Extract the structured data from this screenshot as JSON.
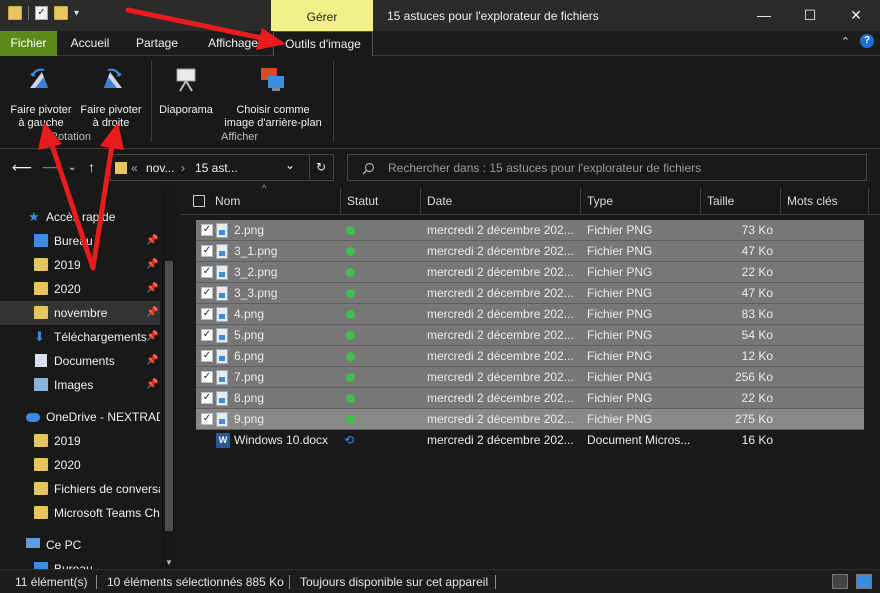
{
  "window": {
    "title": "15 astuces pour l'explorateur de fichiers",
    "context_tab": "Gérer",
    "minimize": "—",
    "maximize": "☐",
    "close": "✕"
  },
  "tabs": [
    "Fichier",
    "Accueil",
    "Partage",
    "Affichage",
    "Outils d'image"
  ],
  "ribbon": {
    "rotate_left": [
      "Faire pivoter",
      "à gauche"
    ],
    "rotate_right": [
      "Faire pivoter",
      "à droite"
    ],
    "rotation_group": "Rotation",
    "slideshow": "Diaporama",
    "set_background": [
      "Choisir comme",
      "image d'arrière-plan"
    ],
    "display_group": "Afficher"
  },
  "address": {
    "chevrons": "«",
    "crumb1": "nov...",
    "crumb2": "15 ast...",
    "dropdown": "⌄",
    "refresh": "↻"
  },
  "search": {
    "placeholder": "Rechercher dans : 15 astuces pour l'explorateur de fichiers"
  },
  "nav": {
    "items": [
      {
        "label": "Accès rapide",
        "icon": "star-icon",
        "pinned": false
      },
      {
        "label": "Bureau",
        "icon": "desktop-icon",
        "pinned": true
      },
      {
        "label": "2019",
        "icon": "folder-icon",
        "pinned": true
      },
      {
        "label": "2020",
        "icon": "folder-icon",
        "pinned": true
      },
      {
        "label": "novembre",
        "icon": "folder-icon",
        "pinned": true
      },
      {
        "label": "Téléchargements",
        "icon": "download-icon",
        "pinned": true
      },
      {
        "label": "Documents",
        "icon": "documents-icon",
        "pinned": true
      },
      {
        "label": "Images",
        "icon": "images-icon",
        "pinned": true
      },
      {
        "label": "OneDrive - NEXTRADI",
        "icon": "cloud-icon",
        "pinned": false
      },
      {
        "label": "2019",
        "icon": "folder-icon",
        "pinned": false
      },
      {
        "label": "2020",
        "icon": "folder-icon",
        "pinned": false
      },
      {
        "label": "Fichiers de conversa",
        "icon": "folder-icon",
        "pinned": false
      },
      {
        "label": "Microsoft Teams Ch",
        "icon": "folder-icon",
        "pinned": false
      },
      {
        "label": "Ce PC",
        "icon": "computer-icon",
        "pinned": false
      },
      {
        "label": "Bureau",
        "icon": "desktop-icon",
        "pinned": false
      }
    ]
  },
  "columns": {
    "name": "Nom",
    "status": "Statut",
    "date": "Date",
    "type": "Type",
    "size": "Taille",
    "tags": "Mots clés"
  },
  "files": [
    {
      "name": "2.png",
      "date": "mercredi 2 décembre 202...",
      "type": "Fichier PNG",
      "size": "73 Ko",
      "selected": true
    },
    {
      "name": "3_1.png",
      "date": "mercredi 2 décembre 202...",
      "type": "Fichier PNG",
      "size": "47 Ko",
      "selected": true
    },
    {
      "name": "3_2.png",
      "date": "mercredi 2 décembre 202...",
      "type": "Fichier PNG",
      "size": "22 Ko",
      "selected": true
    },
    {
      "name": "3_3.png",
      "date": "mercredi 2 décembre 202...",
      "type": "Fichier PNG",
      "size": "47 Ko",
      "selected": true
    },
    {
      "name": "4.png",
      "date": "mercredi 2 décembre 202...",
      "type": "Fichier PNG",
      "size": "83 Ko",
      "selected": true
    },
    {
      "name": "5.png",
      "date": "mercredi 2 décembre 202...",
      "type": "Fichier PNG",
      "size": "54 Ko",
      "selected": true
    },
    {
      "name": "6.png",
      "date": "mercredi 2 décembre 202...",
      "type": "Fichier PNG",
      "size": "12 Ko",
      "selected": true
    },
    {
      "name": "7.png",
      "date": "mercredi 2 décembre 202...",
      "type": "Fichier PNG",
      "size": "256 Ko",
      "selected": true
    },
    {
      "name": "8.png",
      "date": "mercredi 2 décembre 202...",
      "type": "Fichier PNG",
      "size": "22 Ko",
      "selected": true
    },
    {
      "name": "9.png",
      "date": "mercredi 2 décembre 202...",
      "type": "Fichier PNG",
      "size": "275 Ko",
      "selected": true
    },
    {
      "name": "Windows 10.docx",
      "date": "mercredi 2 décembre 202...",
      "type": "Document Micros...",
      "size": "16 Ko",
      "selected": false
    }
  ],
  "statusbar": {
    "count": "11 élément(s)",
    "selected": "10 éléments sélectionnés  885 Ko",
    "availability": "Toujours disponible sur cet appareil"
  },
  "colors": {
    "accent_green": "#5b8a1a",
    "context_yellow": "#f3f08a",
    "annotation_red": "#e81c1c",
    "selection_grey": "#777777"
  }
}
